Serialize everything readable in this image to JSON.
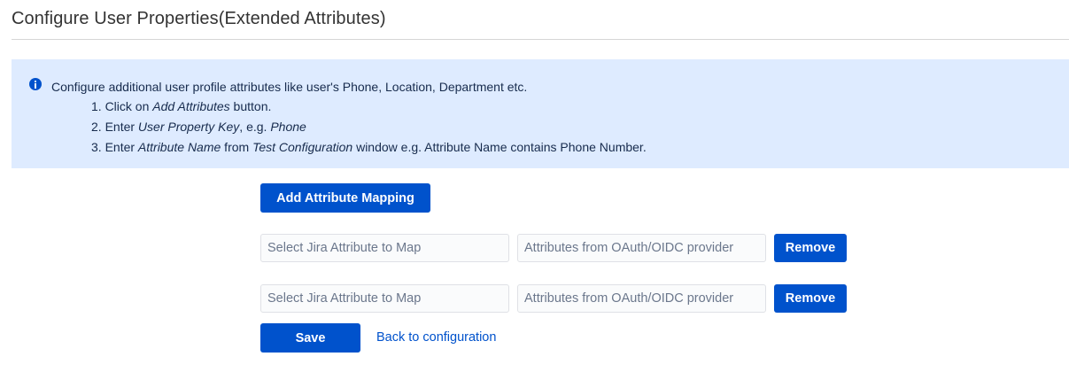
{
  "page": {
    "title": "Configure User Properties(Extended Attributes)"
  },
  "info": {
    "intro": "Configure additional user profile attributes like user's Phone, Location, Department etc.",
    "step1": {
      "prefix": "1. Click on ",
      "em": "Add Attributes",
      "suffix": " button."
    },
    "step2": {
      "prefix": "2. Enter ",
      "em1": "User Property Key",
      "mid": ", e.g. ",
      "em2": "Phone"
    },
    "step3": {
      "prefix": "3. Enter ",
      "em1": "Attribute Name",
      "mid": " from ",
      "em2": "Test Configuration",
      "suffix": " window e.g. Attribute Name contains Phone Number."
    },
    "icon": "info-icon"
  },
  "actions": {
    "add_mapping_label": "Add Attribute Mapping",
    "save_label": "Save",
    "back_label": "Back to configuration"
  },
  "mappings": [
    {
      "jira_placeholder": "Select Jira Attribute to Map",
      "jira_value": "",
      "oauth_placeholder": "Attributes from OAuth/OIDC provider",
      "oauth_value": "",
      "remove_label": "Remove"
    },
    {
      "jira_placeholder": "Select Jira Attribute to Map",
      "jira_value": "",
      "oauth_placeholder": "Attributes from OAuth/OIDC provider",
      "oauth_value": "",
      "remove_label": "Remove"
    }
  ],
  "colors": {
    "primary": "#0052cc",
    "info_background": "#deebff",
    "text": "#172b4d"
  }
}
